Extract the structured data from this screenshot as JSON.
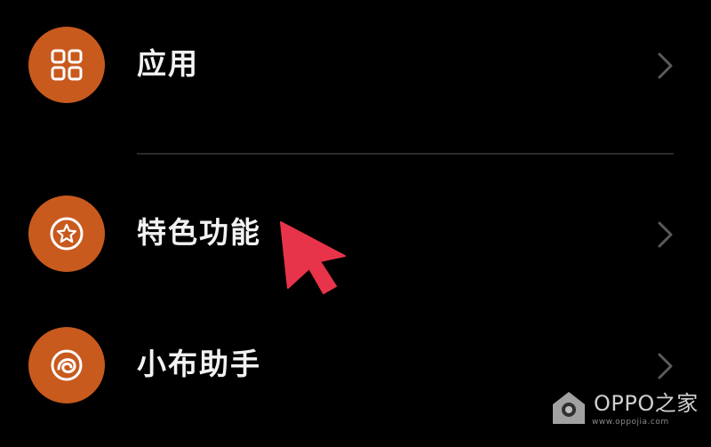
{
  "menu": {
    "items": [
      {
        "label": "应用",
        "icon": "apps-grid-icon"
      },
      {
        "label": "特色功能",
        "icon": "star-badge-icon"
      },
      {
        "label": "小布助手",
        "icon": "breeno-assistant-icon"
      }
    ]
  },
  "watermark": {
    "brand": "OPPO之家",
    "site": "www.oppojia.com"
  },
  "colors": {
    "background": "#000000",
    "icon_bg": "#C85A1E",
    "pointer": "#E8344A",
    "chevron": "#5a5a5a",
    "divider": "#2a2a2a"
  }
}
